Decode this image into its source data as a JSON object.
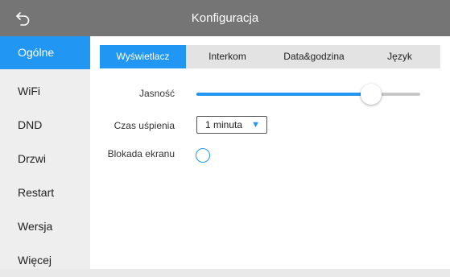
{
  "header": {
    "title": "Konfiguracja",
    "back_icon": "back-arrow-icon"
  },
  "sidebar": {
    "items": [
      {
        "label": "Ogólne",
        "active": true
      },
      {
        "label": "WiFi",
        "active": false
      },
      {
        "label": "DND",
        "active": false
      },
      {
        "label": "Drzwi",
        "active": false
      },
      {
        "label": "Restart",
        "active": false
      },
      {
        "label": "Wersja",
        "active": false
      },
      {
        "label": "Więcej",
        "active": false
      }
    ]
  },
  "tabs": [
    {
      "label": "Wyświetlacz",
      "active": true
    },
    {
      "label": "Interkom",
      "active": false
    },
    {
      "label": "Data&godzina",
      "active": false
    },
    {
      "label": "Język",
      "active": false
    }
  ],
  "settings": {
    "brightness": {
      "label": "Jasność",
      "level_fraction": 0.78
    },
    "sleep": {
      "label": "Czas uśpienia",
      "value": "1 minuta"
    },
    "screen_lock": {
      "label": "Blokada ekranu",
      "enabled": false
    }
  },
  "colors": {
    "accent": "#2196f3",
    "header_bg": "#757575",
    "sidebar_bg": "#eeeeee",
    "tabs_bg": "#e3e3e3"
  }
}
